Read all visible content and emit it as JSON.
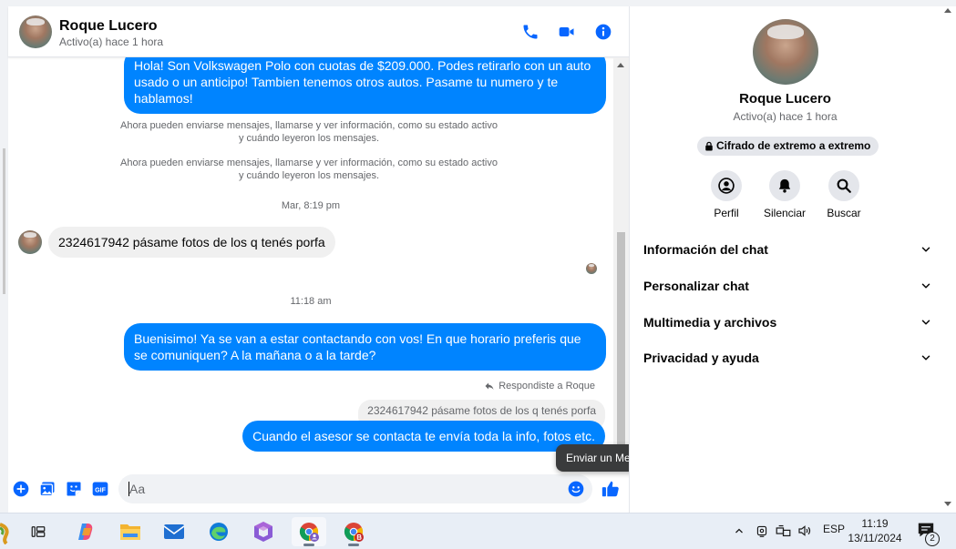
{
  "contact": {
    "name": "Roque Lucero",
    "status": "Activo(a) hace 1 hora"
  },
  "messages": {
    "first_out": "Hola! Son Volkswagen Polo con cuotas de $209.000. Podes retirarlo con un auto usado o un anticipo! Tambien tenemos otros autos. Pasame tu numero y te hablamos!",
    "system_1": "Ahora pueden enviarse mensajes, llamarse y ver información, como su estado activo y cuándo leyeron los mensajes.",
    "system_2": "Ahora pueden enviarse mensajes, llamarse y ver información, como su estado activo y cuándo leyeron los mensajes.",
    "time_1": "Mar, 8:19 pm",
    "incoming_1": "2324617942 pásame fotos de los q tenés porfa",
    "time_2": "11:18 am",
    "out_2": "Buenisimo! Ya se van a estar contactando con vos! En que horario preferis que se comuniquen? A la mañana o a la tarde?",
    "reply_note": "Respondiste a Roque",
    "quoted": "2324617942 pásame fotos de los q tenés porfa",
    "out_3": "Cuando el asesor se contacta te envía toda la info, fotos etc."
  },
  "composer": {
    "placeholder": "Aa",
    "gif_label": "GIF"
  },
  "tooltip": "Enviar un Me gusta",
  "side": {
    "e2e": "Cifrado de extremo a extremo",
    "actions": [
      {
        "label": "Perfil",
        "icon": "profile-icon"
      },
      {
        "label": "Silenciar",
        "icon": "bell-icon"
      },
      {
        "label": "Buscar",
        "icon": "search-icon"
      }
    ],
    "sections": [
      "Información del chat",
      "Personalizar chat",
      "Multimedia y archivos",
      "Privacidad y ayuda"
    ]
  },
  "taskbar": {
    "lang": "ESP",
    "time": "11:19",
    "date": "13/11/2024",
    "notifications": "2"
  },
  "colors": {
    "accent": "#0084ff",
    "messenger_blue": "#0866ff"
  }
}
